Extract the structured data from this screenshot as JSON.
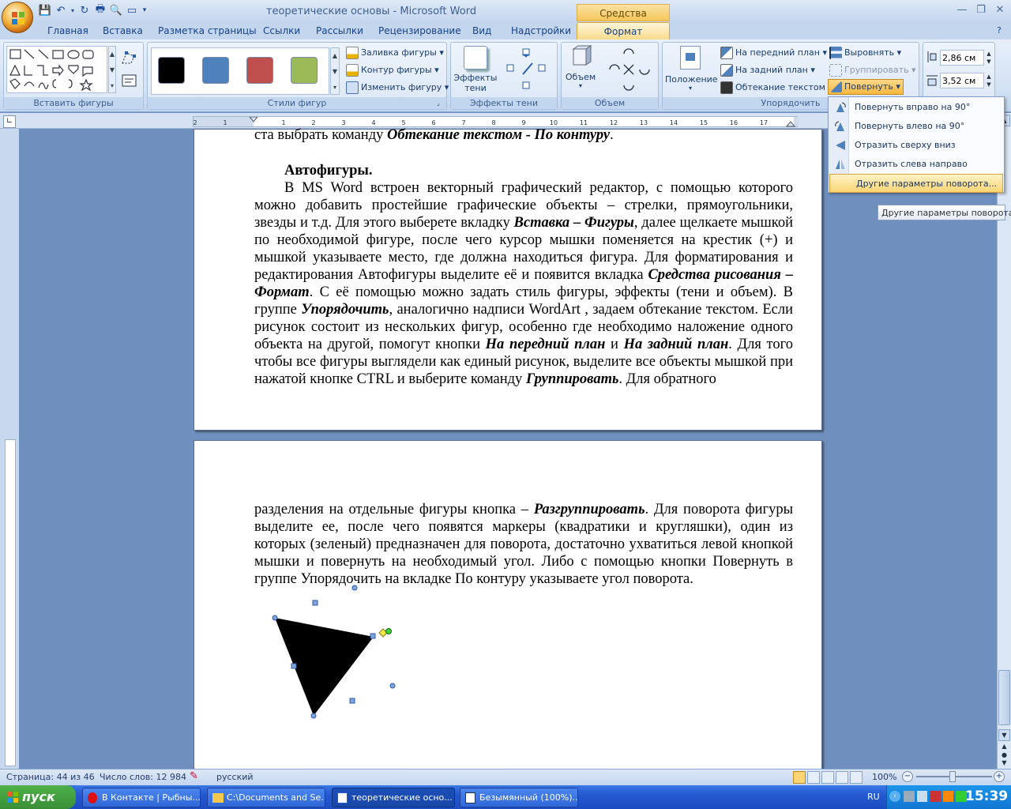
{
  "window": {
    "title": "теоретические основы - Microsoft Word",
    "context_tab_title": "Средства рисования"
  },
  "tabs": [
    "Главная",
    "Вставка",
    "Разметка страницы",
    "Ссылки",
    "Рассылки",
    "Рецензирование",
    "Вид",
    "Надстройки",
    "Формат"
  ],
  "ribbon": {
    "groups": {
      "insert_shapes": "Вставить фигуры",
      "shape_styles": "Стили фигур",
      "shadow_effects": "Эффекты тени",
      "volume": "Объем",
      "arrange": "Упорядочить"
    },
    "shape_fill": "Заливка фигуры",
    "shape_outline": "Контур фигуры",
    "change_shape": "Изменить фигуру",
    "shadow_line1": "Эффекты",
    "shadow_line2": "тени",
    "volume_btn": "Объем",
    "position": "Положение",
    "bring_front": "На передний план",
    "send_back": "На задний план",
    "text_wrap": "Обтекание текстом",
    "align": "Выровнять",
    "group": "Группировать",
    "rotate": "Повернуть",
    "height": "2,86 см",
    "width": "3,52 см",
    "swatch_colors": [
      "#000000",
      "#4f81bd",
      "#c0504d",
      "#9bbb59"
    ]
  },
  "rotate_menu": {
    "items": [
      "Повернуть вправо на 90°",
      "Повернуть влево на 90°",
      "Отразить сверху вниз",
      "Отразить слева направо"
    ],
    "more": "Другие параметры поворота...",
    "tooltip": "Другие параметры поворота"
  },
  "document": {
    "page1": {
      "line0a": "ста выбрать команду ",
      "line0b": "Обтекание текстом - По контуру",
      "line0c": ".",
      "heading": "Автофигуры.",
      "p_a": "В MS Word встроен векторный графический редактор, с помощью которого можно добавить простейшие графические объекты – стрелки, прямоугольники, звезды и т.д. Для этого  выберете вкладку ",
      "p_b": "Вставка – Фигуры",
      "p_c": ", далее щелкаете мышкой по необходимой фигуре, после чего курсор мышки поменяется на крестик (+) и мышкой указываете место, где должна находиться фигура.  Для форматирования и редактирования Автофигуры выделите её и появится вкладка ",
      "p_d": "Средства рисования – Формат",
      "p_e": ". С её помощью можно задать стиль фигуры, эффекты (тени и объем). В группе ",
      "p_f": "Упорядочить",
      "p_g": ", аналогично надписи WordArt , задаем обтекание текстом. Если рисунок состоит из нескольких фигур, особенно где необходимо наложение одного объекта на другой, помогут кнопки ",
      "p_h": "На передний план",
      "p_i": " и ",
      "p_j": "На задний план",
      "p_k": ". Для того чтобы все фигуры выглядели как единый рисунок, выделите все объекты мышкой при нажатой кнопке CTRL и выберите команду ",
      "p_l": "Группировать",
      "p_m": ". Для обратного"
    },
    "page2": {
      "p_a": "разделения на отдельные фигуры кнопка – ",
      "p_b": "Разгруппировать",
      "p_c": ". Для поворота фигуры выделите ее, после чего появятся маркеры (квадратики и кругляшки), один из которых (зеленый) предназначен для поворота, достаточно ухватиться левой кнопкой мышки и повернуть на необходимый угол. Либо с помощью кнопки Повернуть в группе Упорядочить на вкладке По контуру указываете угол поворота."
    }
  },
  "status": {
    "page": "Страница: 44 из 46",
    "words": "Число слов: 12 984",
    "lang": "русский",
    "zoom": "100%"
  },
  "taskbar": {
    "start": "пуск",
    "tasks": [
      "В Контакте | Рыбны...",
      "C:\\Documents and Se...",
      "теоретические осно...",
      "Безымянный (100%)..."
    ],
    "lang": "RU",
    "time": "15:39"
  }
}
